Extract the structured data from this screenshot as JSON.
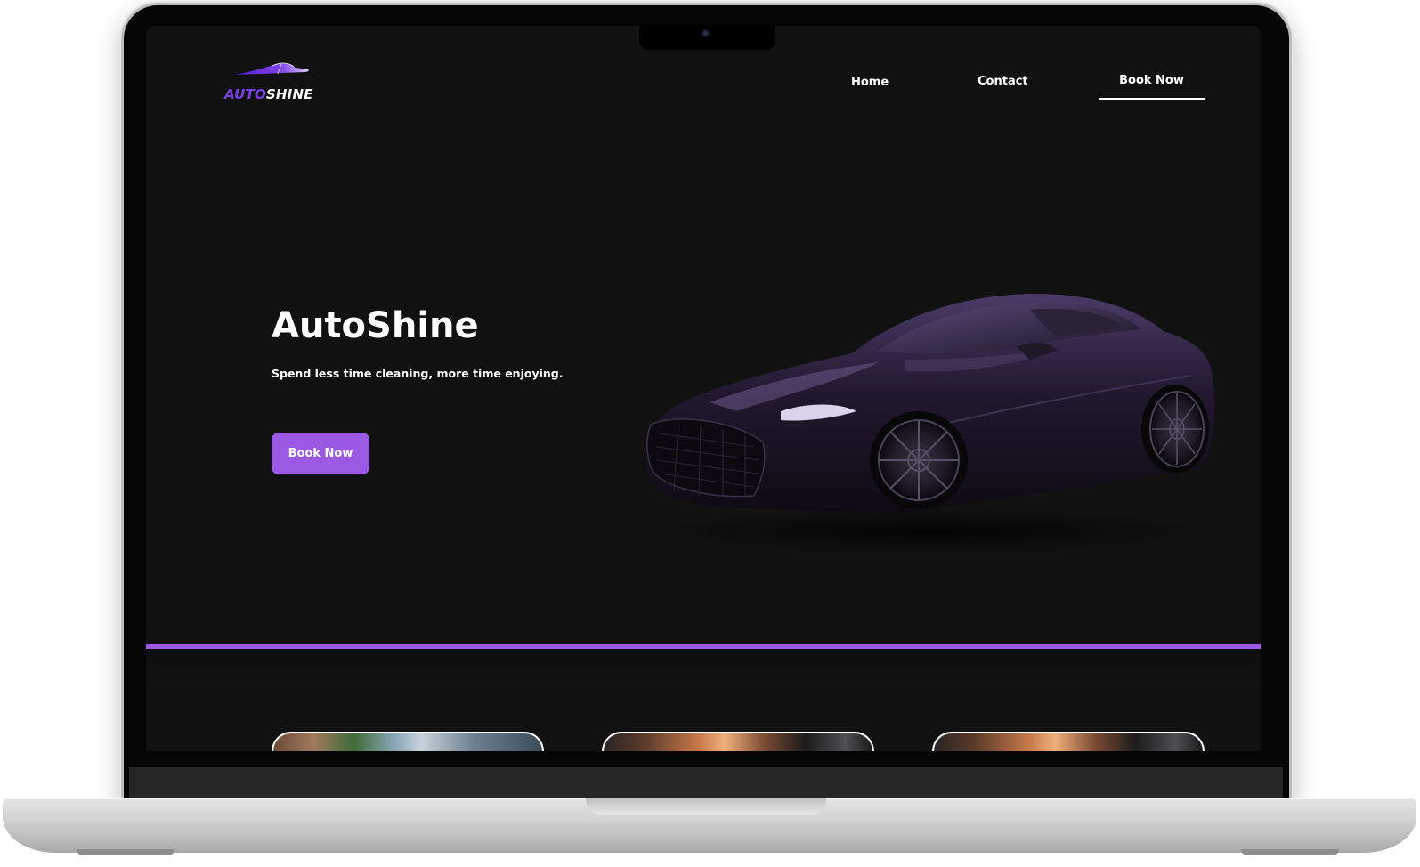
{
  "brand": {
    "logo_part1": "AUTO",
    "logo_part2": "SHINE",
    "accent_color": "#9b59e4",
    "logo_color": "#7b3fe6"
  },
  "nav": {
    "home": "Home",
    "contact": "Contact",
    "book_now": "Book Now"
  },
  "hero": {
    "title": "AutoShine",
    "subtitle": "Spend less time cleaning, more time enjoying.",
    "cta": "Book Now",
    "image_icon": "sports-car-image"
  },
  "services": {
    "cards": [
      {
        "image": "car-wash-photo"
      },
      {
        "image": "car-interior-photo"
      },
      {
        "image": "car-interior-photo"
      }
    ]
  }
}
